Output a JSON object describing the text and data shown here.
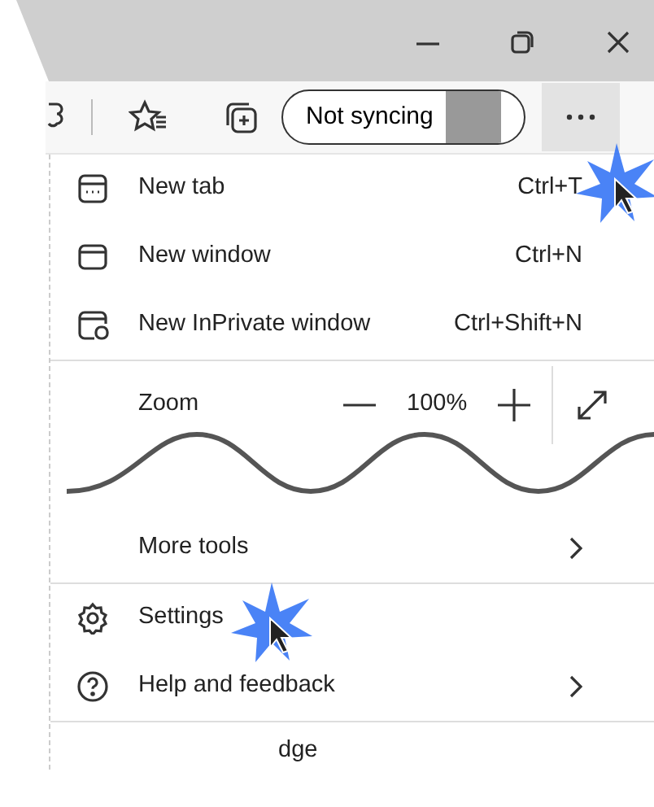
{
  "toolbar": {
    "profile": {
      "label": "Not syncing"
    },
    "menu_button": {
      "active": true
    }
  },
  "menu": {
    "items": [
      {
        "kind": "item",
        "label": "New tab",
        "shortcut": "Ctrl+T"
      },
      {
        "kind": "item",
        "label": "New window",
        "shortcut": "Ctrl+N"
      },
      {
        "kind": "item",
        "label": "New InPrivate window",
        "shortcut": "Ctrl+Shift+N"
      },
      {
        "kind": "zoom",
        "label": "Zoom",
        "value": "100%"
      },
      {
        "kind": "tear"
      },
      {
        "kind": "submenu",
        "label": "More tools"
      },
      {
        "kind": "item",
        "label": "Settings"
      },
      {
        "kind": "submenu",
        "label": "Help and feedback"
      },
      {
        "kind": "partial",
        "label": "dge"
      }
    ]
  }
}
